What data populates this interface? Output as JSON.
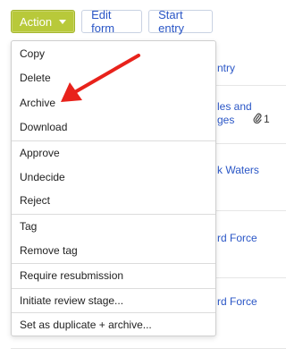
{
  "toolbar": {
    "action_label": "Action",
    "edit_form_label": "Edit form",
    "start_entry_label": "Start entry"
  },
  "background": {
    "column_header_fragment": "ntry",
    "row1_line1": "les and",
    "row1_line2": "ges",
    "row1_attachment_count": "1",
    "row2_fragment": "k Waters",
    "row3_fragment": "rd Force",
    "row4_fragment": "rd Force"
  },
  "dropdown": {
    "items": [
      {
        "label": "Copy"
      },
      {
        "label": "Delete"
      },
      {
        "label": "Archive"
      },
      {
        "label": "Download"
      },
      {
        "label": "Approve"
      },
      {
        "label": "Undecide"
      },
      {
        "label": "Reject"
      },
      {
        "label": "Tag"
      },
      {
        "label": "Remove tag"
      },
      {
        "label": "Require resubmission"
      },
      {
        "label": "Initiate review stage..."
      },
      {
        "label": "Set as duplicate + archive..."
      }
    ]
  },
  "colors": {
    "action_button": "#b8c93a",
    "link": "#2a56c6",
    "annotation_arrow": "#e8221b"
  }
}
